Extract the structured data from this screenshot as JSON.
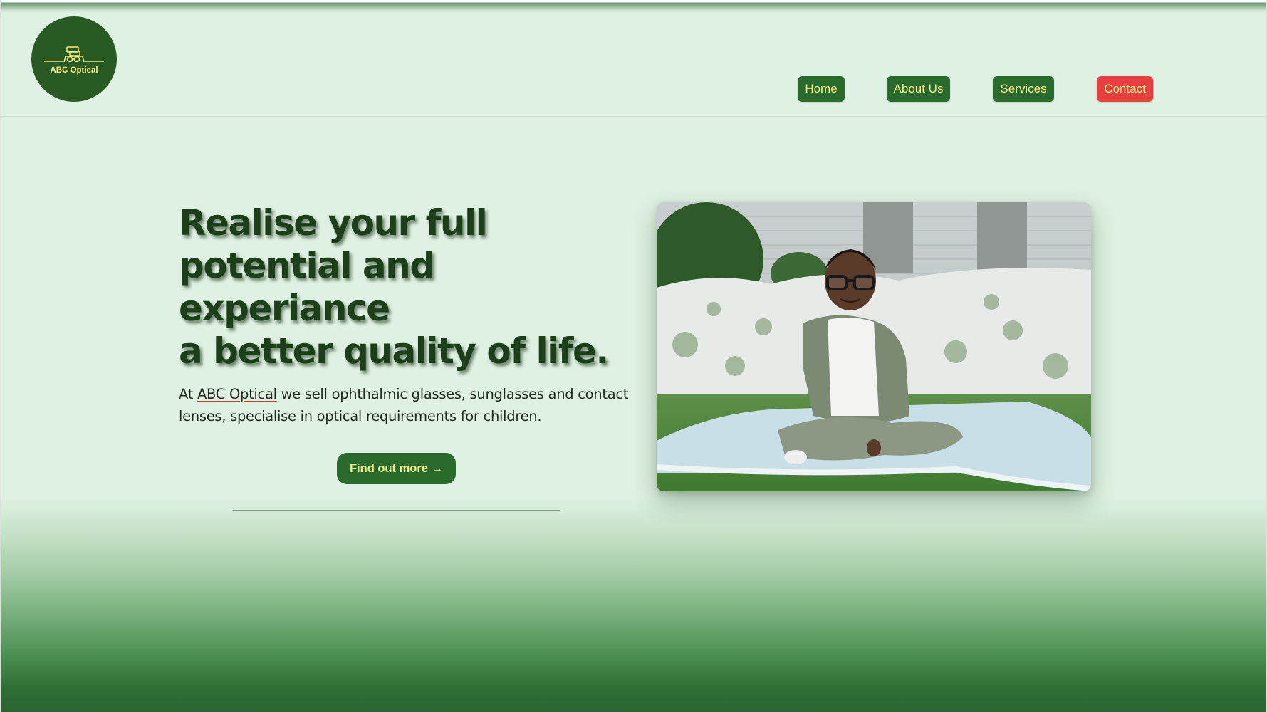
{
  "header": {
    "logo_text": "ABC Optical",
    "nav": [
      {
        "label": "Home",
        "color": "#2a6a2d"
      },
      {
        "label": "About Us",
        "color": "#2a6a2d"
      },
      {
        "label": "Services",
        "color": "#2a6a2d"
      },
      {
        "label": "Contact",
        "color": "#e64040"
      }
    ]
  },
  "hero": {
    "headline_lines": [
      "Realise your full",
      "potential and experiance",
      "a better quality of life."
    ],
    "lede_prefix": "At ",
    "brand_link": "ABC Optical",
    "lede_suffix": " we sell ophthalmic glasses, sunglasses and contact lenses, specialise in optical requirements for children.",
    "cta_label": "Find out more →"
  },
  "colors": {
    "brand_green": "#2a6a2d",
    "accent_yellow": "#f3ed8a",
    "contact_red": "#e64040",
    "page_background": "#dff1e2"
  },
  "icons": {
    "logo": "glasses-box-icon"
  }
}
